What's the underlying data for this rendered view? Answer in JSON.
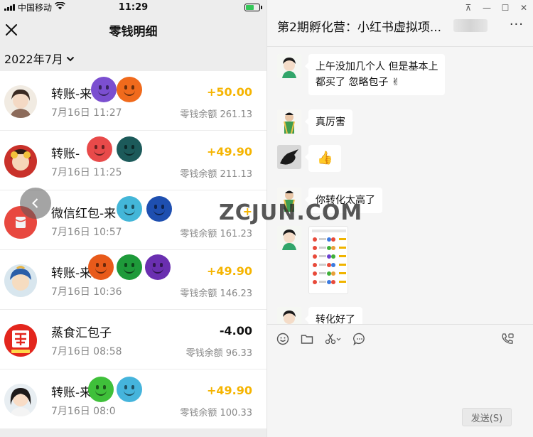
{
  "phone": {
    "status": {
      "carrier": "中国移动",
      "time": "11:29"
    },
    "nav": {
      "title": "零钱明细"
    },
    "month_filter": "2022年7月",
    "transactions": [
      {
        "name": "转账-来",
        "date": "7月16日 11:27",
        "amount": "+50.00",
        "balance": "零钱余额 261.13",
        "sign": "pos"
      },
      {
        "name": "转账-",
        "date": "7月16日 11:25",
        "amount": "+49.90",
        "balance": "零钱余额 211.13",
        "sign": "pos"
      },
      {
        "name": "微信红包-来",
        "date": "7月16日 10:57",
        "amount": "+",
        "balance": "零钱余额 161.23",
        "sign": "pos"
      },
      {
        "name": "转账-来自",
        "date": "7月16日 10:36",
        "amount": "+49.90",
        "balance": "零钱余额 146.23",
        "sign": "pos"
      },
      {
        "name": "蒸食汇包子",
        "date": "7月16日 08:58",
        "amount": "-4.00",
        "balance": "零钱余额 96.33",
        "sign": "neg"
      },
      {
        "name": "转账-来",
        "date": "7月16日 08:0",
        "amount": "+49.90",
        "balance": "零钱余额 100.33",
        "sign": "pos"
      }
    ]
  },
  "chat": {
    "title": "第2期孵化营：小红书虚拟项...",
    "more_label": "···",
    "window_controls": [
      "⊼",
      "—",
      "☐",
      "✕"
    ],
    "messages": [
      {
        "line1": "上午没加几个人 但是基本上",
        "line2": "都买了  忽略包子 ✌"
      },
      {
        "text": "真厉害"
      },
      {
        "text": "👍"
      },
      {
        "text": "你转化太高了"
      },
      {
        "text": "转化好了"
      }
    ],
    "send_label": "发送(S)"
  },
  "watermark": "ZCJUN.COM",
  "icons": [
    "close-icon",
    "chevron-down-icon",
    "back-arrow-icon",
    "red-envelope-icon",
    "emoji-icon",
    "folder-icon",
    "scissors-icon",
    "chat-bubble-icon",
    "video-call-icon",
    "wifi-icon",
    "battery-icon"
  ],
  "colors": {
    "income": "#f5b400",
    "expense": "#111111",
    "wechat_bg": "#ededed",
    "red_envelope": "#e8483f"
  }
}
